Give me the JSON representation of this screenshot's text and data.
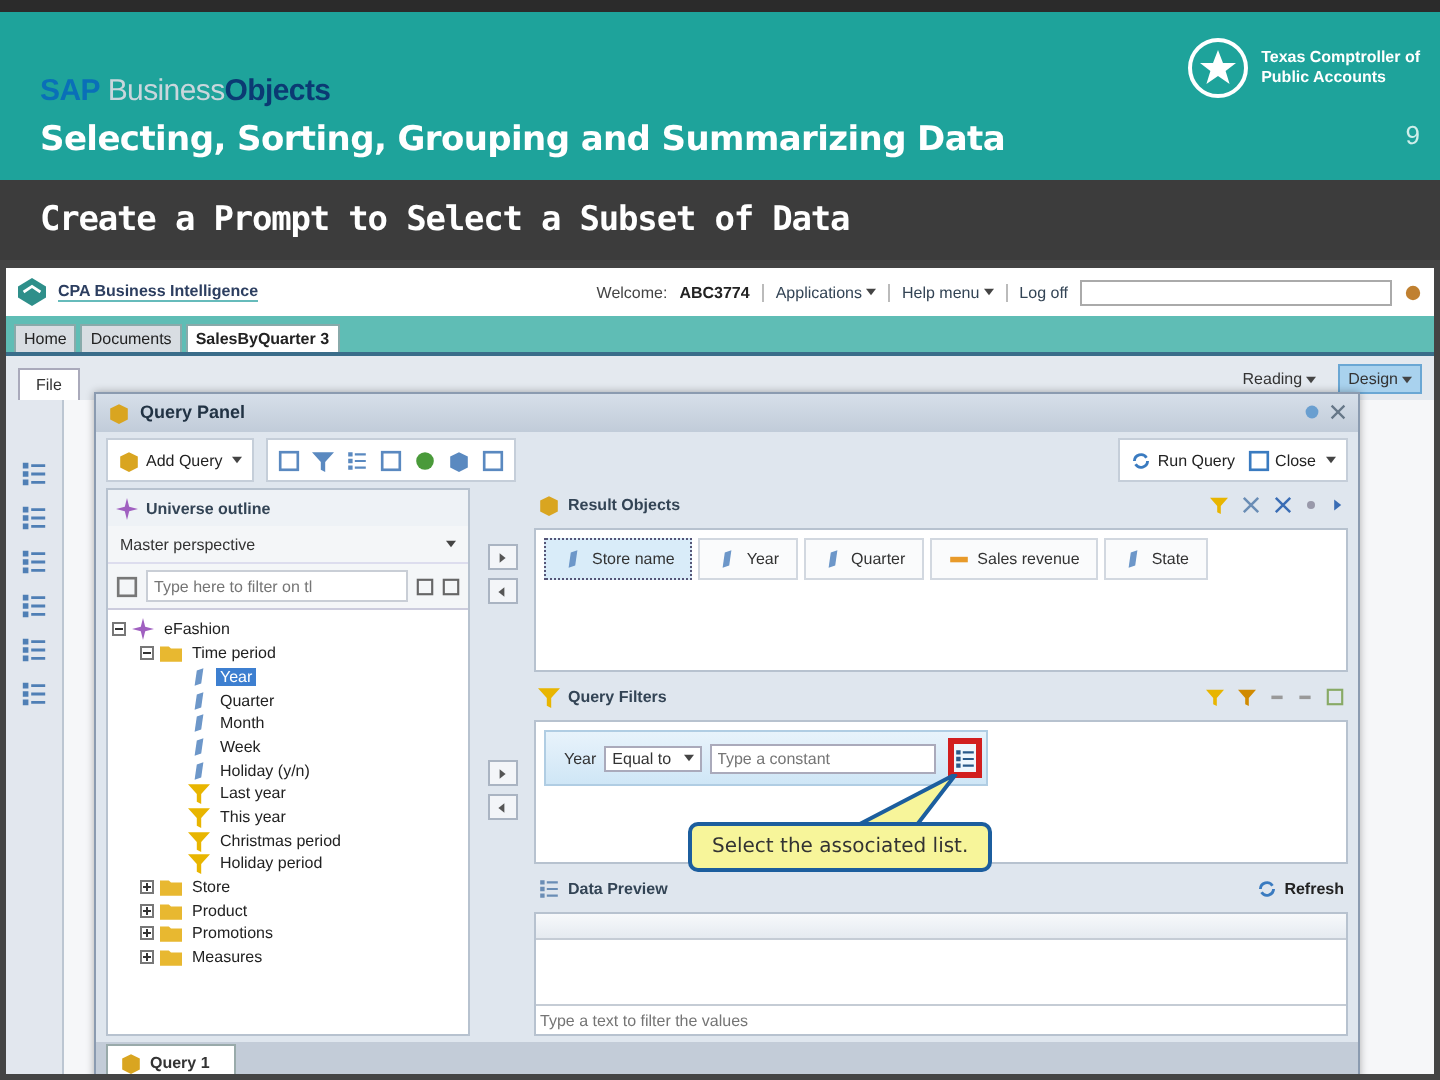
{
  "slide": {
    "brand": {
      "sap": "SAP",
      "business": "Business",
      "objects": "Objects"
    },
    "title": "Selecting, Sorting, Grouping and Summarizing Data",
    "agency": {
      "line1": "Texas Comptroller of",
      "line2": "Public Accounts"
    },
    "page_number": "9",
    "subtitle": "Create a Prompt to Select a Subset of Data"
  },
  "app": {
    "name": "CPA Business Intelligence",
    "welcome": "Welcome:",
    "user": "ABC3774",
    "menus": [
      {
        "label": "Applications",
        "dropdown": true
      },
      {
        "label": "Help menu",
        "dropdown": true
      },
      {
        "label": "Log off",
        "dropdown": false
      }
    ],
    "doc_tabs": [
      {
        "label": "Home",
        "selected": false
      },
      {
        "label": "Documents",
        "selected": false
      },
      {
        "label": "SalesByQuarter 3",
        "selected": true
      }
    ],
    "ribbon_tab": "File",
    "view_modes": [
      {
        "label": "Reading",
        "selected": false
      },
      {
        "label": "Design",
        "selected": true
      }
    ]
  },
  "query_panel": {
    "title": "Query Panel",
    "add_query": "Add Query",
    "run_query": "Run Query",
    "close": "Close",
    "outline": {
      "title": "Universe outline",
      "perspective": "Master perspective",
      "filter_placeholder": "Type here to filter on tl",
      "tree": [
        {
          "label": "eFashion",
          "kind": "universe",
          "expanded": true,
          "selected": false,
          "children": [
            {
              "label": "Time period",
              "kind": "folder",
              "expanded": true,
              "selected": false,
              "children": [
                {
                  "label": "Year",
                  "kind": "dimension",
                  "selected": true
                },
                {
                  "label": "Quarter",
                  "kind": "dimension",
                  "selected": false
                },
                {
                  "label": "Month",
                  "kind": "dimension",
                  "selected": false
                },
                {
                  "label": "Week",
                  "kind": "dimension",
                  "selected": false
                },
                {
                  "label": "Holiday (y/n)",
                  "kind": "dimension",
                  "selected": false
                },
                {
                  "label": "Last year",
                  "kind": "filter",
                  "selected": false
                },
                {
                  "label": "This year",
                  "kind": "filter",
                  "selected": false
                },
                {
                  "label": "Christmas period",
                  "kind": "filter",
                  "selected": false
                },
                {
                  "label": "Holiday period",
                  "kind": "filter",
                  "selected": false
                }
              ]
            },
            {
              "label": "Store",
              "kind": "folder",
              "expanded": false,
              "selected": false
            },
            {
              "label": "Product",
              "kind": "folder",
              "expanded": false,
              "selected": false
            },
            {
              "label": "Promotions",
              "kind": "folder",
              "expanded": false,
              "selected": false
            },
            {
              "label": "Measures",
              "kind": "folder",
              "expanded": false,
              "selected": false
            }
          ]
        }
      ]
    },
    "result_objects": {
      "title": "Result Objects",
      "items": [
        {
          "label": "Store name",
          "kind": "dimension",
          "selected": true
        },
        {
          "label": "Year",
          "kind": "dimension",
          "selected": false
        },
        {
          "label": "Quarter",
          "kind": "dimension",
          "selected": false
        },
        {
          "label": "Sales revenue",
          "kind": "measure",
          "selected": false
        },
        {
          "label": "State",
          "kind": "dimension",
          "selected": false
        }
      ]
    },
    "query_filters": {
      "title": "Query Filters",
      "filter": {
        "object": "Year",
        "operator": "Equal to",
        "placeholder": "Type a constant"
      },
      "callout": "Select the associated list."
    },
    "data_preview": {
      "title": "Data Preview",
      "refresh": "Refresh",
      "filter_placeholder": "Type a text to filter the values"
    },
    "query_tabs": [
      {
        "label": "Query 1",
        "selected": true
      }
    ]
  }
}
